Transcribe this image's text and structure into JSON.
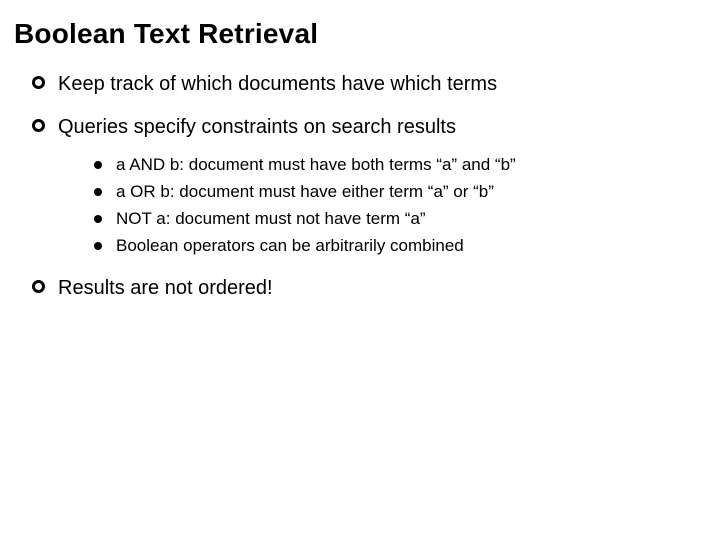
{
  "title": "Boolean Text Retrieval",
  "bullets": [
    {
      "text": "Keep track of which documents have which terms"
    },
    {
      "text": "Queries specify constraints on search results",
      "sub": [
        "a AND b: document must have both terms “a” and “b”",
        "a OR b: document must have either term “a” or “b”",
        "NOT a: document must not have term “a”",
        "Boolean operators can be arbitrarily combined"
      ]
    },
    {
      "text": "Results are not ordered!"
    }
  ]
}
